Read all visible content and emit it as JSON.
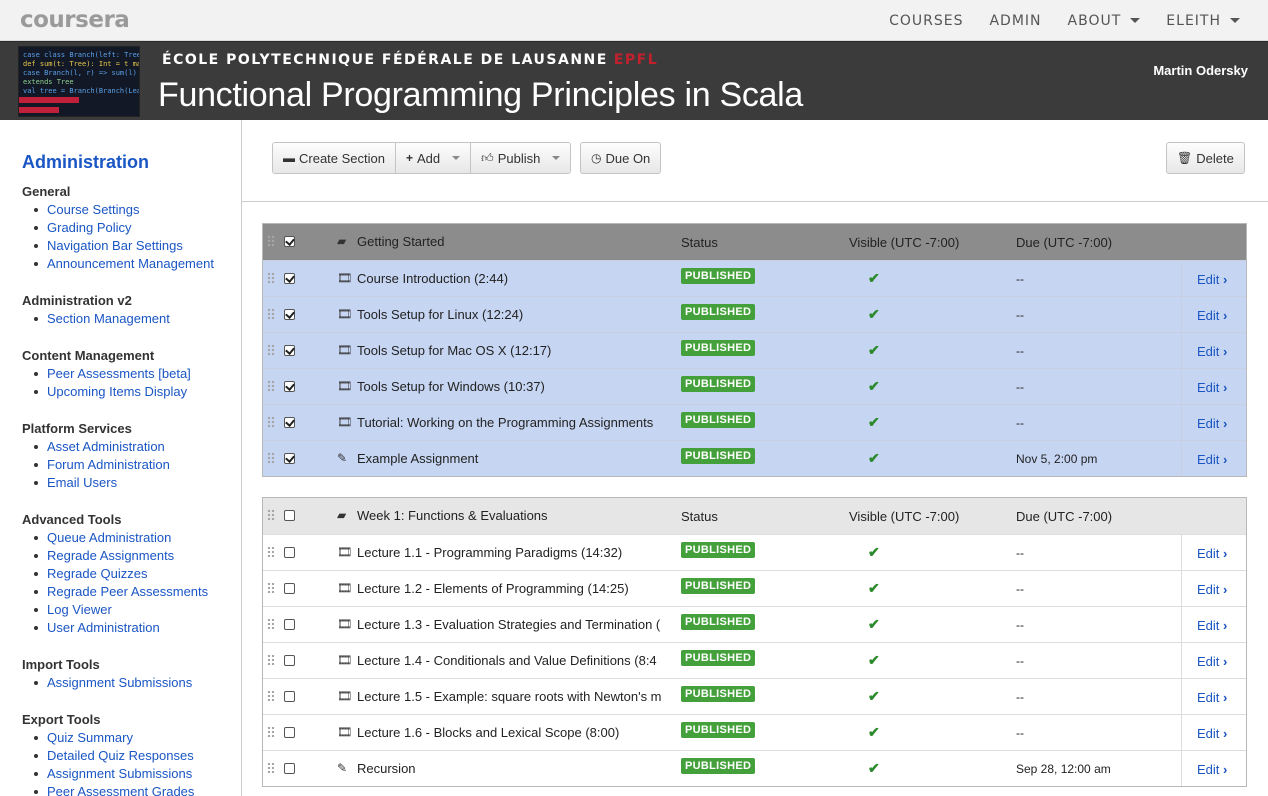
{
  "nav": {
    "logo": "coursera",
    "links": [
      {
        "label": "COURSES",
        "dropdown": false
      },
      {
        "label": "ADMIN",
        "dropdown": false
      },
      {
        "label": "ABOUT",
        "dropdown": true
      },
      {
        "label": "ELEITH",
        "dropdown": true
      }
    ]
  },
  "banner": {
    "school": "ÉCOLE POLYTECHNIQUE FÉDÉRALE DE LAUSANNE",
    "school_tag": "EPFL",
    "course_title": "Functional Programming Principles in Scala",
    "instructor": "Martin Odersky"
  },
  "sidebar": {
    "title": "Administration",
    "groups": [
      {
        "heading": "General",
        "items": [
          "Course Settings",
          "Grading Policy",
          "Navigation Bar Settings",
          "Announcement Management"
        ]
      },
      {
        "heading": "Administration v2",
        "items": [
          "Section Management"
        ]
      },
      {
        "heading": "Content Management",
        "items": [
          "Peer Assessments [beta]",
          "Upcoming Items Display"
        ]
      },
      {
        "heading": "Platform Services",
        "items": [
          "Asset Administration",
          "Forum Administration",
          "Email Users"
        ]
      },
      {
        "heading": "Advanced Tools",
        "items": [
          "Queue Administration",
          "Regrade Assignments",
          "Regrade Quizzes",
          "Regrade Peer Assessments",
          "Log Viewer",
          "User Administration"
        ]
      },
      {
        "heading": "Import Tools",
        "items": [
          "Assignment Submissions"
        ]
      },
      {
        "heading": "Export Tools",
        "items": [
          "Quiz Summary",
          "Detailed Quiz Responses",
          "Assignment Submissions",
          "Peer Assessment Grades"
        ]
      }
    ]
  },
  "toolbar": {
    "create_section": "Create Section",
    "add": "Add",
    "publish": "Publish",
    "due_on": "Due On",
    "delete": "Delete"
  },
  "columns": {
    "status": "Status",
    "visible": "Visible (UTC -7:00)",
    "due": "Due (UTC -7:00)"
  },
  "edit_label": "Edit",
  "sections": [
    {
      "title": "Getting Started",
      "checked": true,
      "items": [
        {
          "kind": "video",
          "title": "Course Introduction (2:44)",
          "status": "PUBLISHED",
          "due": "--"
        },
        {
          "kind": "video",
          "title": "Tools Setup for Linux (12:24)",
          "status": "PUBLISHED",
          "due": "--"
        },
        {
          "kind": "video",
          "title": "Tools Setup for Mac OS X (12:17)",
          "status": "PUBLISHED",
          "due": "--"
        },
        {
          "kind": "video",
          "title": "Tools Setup for Windows (10:37)",
          "status": "PUBLISHED",
          "due": "--"
        },
        {
          "kind": "video",
          "title": "Tutorial: Working on the Programming Assignments",
          "status": "PUBLISHED",
          "due": "--"
        },
        {
          "kind": "assignment",
          "title": "Example Assignment",
          "status": "PUBLISHED",
          "due": "Nov 5, 2:00 pm"
        }
      ]
    },
    {
      "title": "Week 1: Functions & Evaluations",
      "checked": false,
      "items": [
        {
          "kind": "video",
          "title": "Lecture 1.1 - Programming Paradigms (14:32)",
          "status": "PUBLISHED",
          "due": "--"
        },
        {
          "kind": "video",
          "title": "Lecture 1.2 - Elements of Programming (14:25)",
          "status": "PUBLISHED",
          "due": "--"
        },
        {
          "kind": "video",
          "title": "Lecture 1.3 - Evaluation Strategies and Termination (",
          "status": "PUBLISHED",
          "due": "--"
        },
        {
          "kind": "video",
          "title": "Lecture 1.4 - Conditionals and Value Definitions (8:4",
          "status": "PUBLISHED",
          "due": "--"
        },
        {
          "kind": "video",
          "title": "Lecture 1.5 - Example: square roots with Newton's m",
          "status": "PUBLISHED",
          "due": "--"
        },
        {
          "kind": "video",
          "title": "Lecture 1.6 - Blocks and Lexical Scope (8:00)",
          "status": "PUBLISHED",
          "due": "--"
        },
        {
          "kind": "assignment",
          "title": "Recursion",
          "status": "PUBLISHED",
          "due": "Sep 28, 12:00 am"
        }
      ]
    }
  ]
}
